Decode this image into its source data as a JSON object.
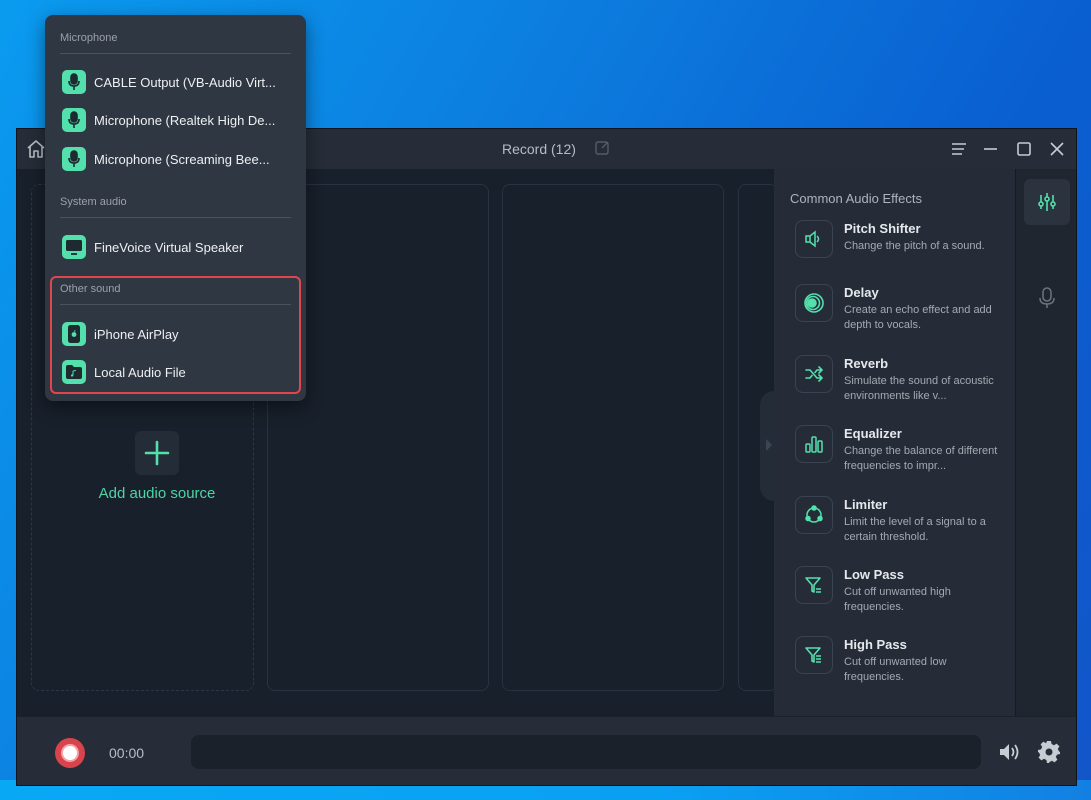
{
  "window": {
    "title": "Record (12)"
  },
  "source_panel": {
    "add_label": "Add audio source"
  },
  "dropdown": {
    "sections": [
      {
        "label": "Microphone",
        "items": [
          {
            "label": "CABLE Output (VB-Audio Virt...",
            "icon": "microphone-icon"
          },
          {
            "label": "Microphone (Realtek High De...",
            "icon": "microphone-icon"
          },
          {
            "label": "Microphone (Screaming Bee...",
            "icon": "microphone-icon"
          }
        ]
      },
      {
        "label": "System audio",
        "items": [
          {
            "label": "FineVoice Virtual Speaker",
            "icon": "monitor-icon"
          }
        ]
      },
      {
        "label": "Other sound",
        "items": [
          {
            "label": "iPhone AirPlay",
            "icon": "iphone-icon"
          },
          {
            "label": "Local Audio File",
            "icon": "music-file-icon"
          }
        ]
      }
    ]
  },
  "effects": {
    "title": "Common Audio Effects",
    "items": [
      {
        "name": "Pitch Shifter",
        "desc": "Change the pitch of a sound.",
        "icon": "speaker-icon"
      },
      {
        "name": "Delay",
        "desc": "Create an echo effect and add depth to vocals.",
        "icon": "echo-icon"
      },
      {
        "name": "Reverb",
        "desc": "Simulate the sound of acoustic environments like v...",
        "icon": "shuffle-icon"
      },
      {
        "name": "Equalizer",
        "desc": "Change the balance of different frequencies to impr...",
        "icon": "equalizer-bars-icon"
      },
      {
        "name": "Limiter",
        "desc": "Limit the level of a signal to a certain threshold.",
        "icon": "cycle-icon"
      },
      {
        "name": "Low Pass",
        "desc": "Cut off unwanted high frequencies.",
        "icon": "filter-icon"
      },
      {
        "name": "High Pass",
        "desc": "Cut off unwanted low frequencies.",
        "icon": "filter-list-icon"
      }
    ]
  },
  "bottom": {
    "timer": "00:00"
  },
  "colors": {
    "accent": "#53e0ad",
    "record": "#d9434b",
    "highlight": "#e0474c"
  }
}
